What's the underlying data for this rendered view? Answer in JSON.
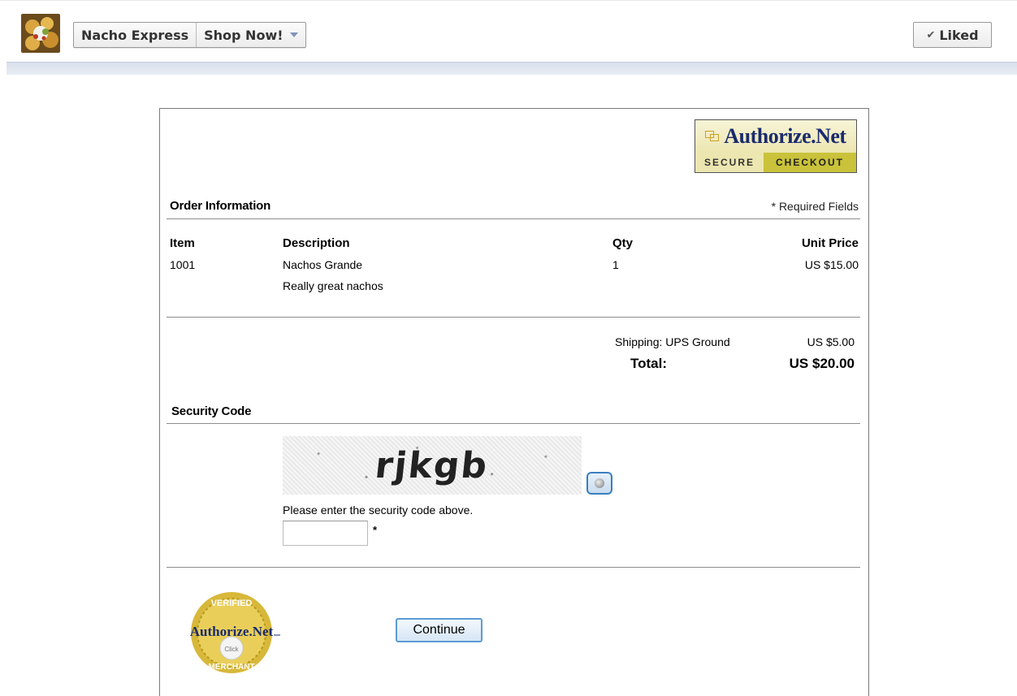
{
  "topbar": {
    "page_name_button": "Nacho Express",
    "shop_button": "Shop Now!",
    "liked_button": "Liked",
    "liked_icon": "check-icon",
    "avatar_icon": "nachos-photo"
  },
  "checkout": {
    "logo": {
      "brand": "Authorize.Net",
      "tagline_left": "SECURE",
      "tagline_right": "CHECKOUT"
    },
    "order": {
      "title": "Order Information",
      "required_note": "* Required Fields",
      "columns": {
        "item": "Item",
        "description": "Description",
        "qty": "Qty",
        "unit_price": "Unit Price"
      },
      "rows": [
        {
          "item": "1001",
          "description": "Nachos Grande",
          "description2": "Really great nachos",
          "qty": "1",
          "unit_price": "US $15.00"
        }
      ],
      "shipping_label": "Shipping: UPS Ground",
      "shipping_value": "US $5.00",
      "total_label": "Total:",
      "total_value": "US $20.00"
    },
    "security": {
      "title": "Security Code",
      "captcha_text": "rjkgb",
      "instruction": "Please enter the security code above.",
      "input_value": "",
      "required_star": "*",
      "audio_icon": "audio-speaker-icon"
    },
    "footer": {
      "seal_top": "VERIFIED",
      "seal_brand": "Authorize.Net",
      "seal_click": "Click",
      "seal_bottom": "MERCHANT",
      "continue_button": "Continue"
    }
  },
  "colors": {
    "brand_navy": "#1a2b6d",
    "seal_gold": "#d8b83a",
    "button_border": "#5b9bd5",
    "divider": "#8c8c8c"
  }
}
